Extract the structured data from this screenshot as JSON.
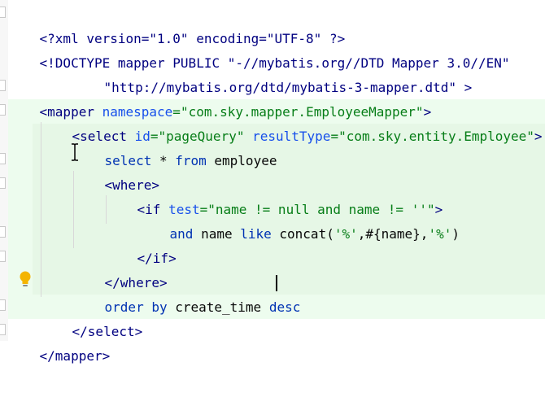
{
  "editor": {
    "line1": {
      "text": "<?xml version=\"1.0\" encoding=\"UTF-8\" ?>"
    },
    "line2": {
      "text": "<!DOCTYPE mapper PUBLIC \"-//mybatis.org//DTD Mapper 3.0//EN\""
    },
    "line3": {
      "text": "\"http://mybatis.org/dtd/mybatis-3-mapper.dtd\" >"
    },
    "line4": {
      "open": "<mapper ",
      "attr": "namespace",
      "eq": "=",
      "val": "\"com.sky.mapper.EmployeeMapper\"",
      "close": ">"
    },
    "line5": {
      "open": "<select ",
      "attr1": "id",
      "val1": "\"pageQuery\"",
      "attr2": "resultType",
      "val2": "\"com.sky.entity.Employee\"",
      "close": ">"
    },
    "line6": {
      "kw1": "select",
      "sym": " * ",
      "kw2": "from",
      "ident": " employee"
    },
    "line7": {
      "text": "<where>"
    },
    "line8": {
      "open": "<if ",
      "attr": "test",
      "val": "\"name != null and name != ''\"",
      "close": ">"
    },
    "line9": {
      "kw1": "and",
      "ident1": " name ",
      "kw2": "like",
      "ident2": " concat(",
      "str1": "'%'",
      "mid": ",#{name},",
      "str2": "'%'",
      "end": ")"
    },
    "line10": {
      "text": "</if>"
    },
    "line11": {
      "text": "</where>"
    },
    "line12": {
      "kw1": "order by",
      "ident": " create_time ",
      "kw2": "desc"
    },
    "line13": {
      "text": "</select>"
    },
    "line14": {
      "text": "</mapper>"
    }
  },
  "colors": {
    "tag": "#000080",
    "attribute": "#1750eb",
    "value": "#067d17",
    "keyword": "#0033b3",
    "highlight": "#edfcee"
  },
  "icons": [
    "lightbulb-icon",
    "text-cursor-icon",
    "fold-marker-icon"
  ]
}
